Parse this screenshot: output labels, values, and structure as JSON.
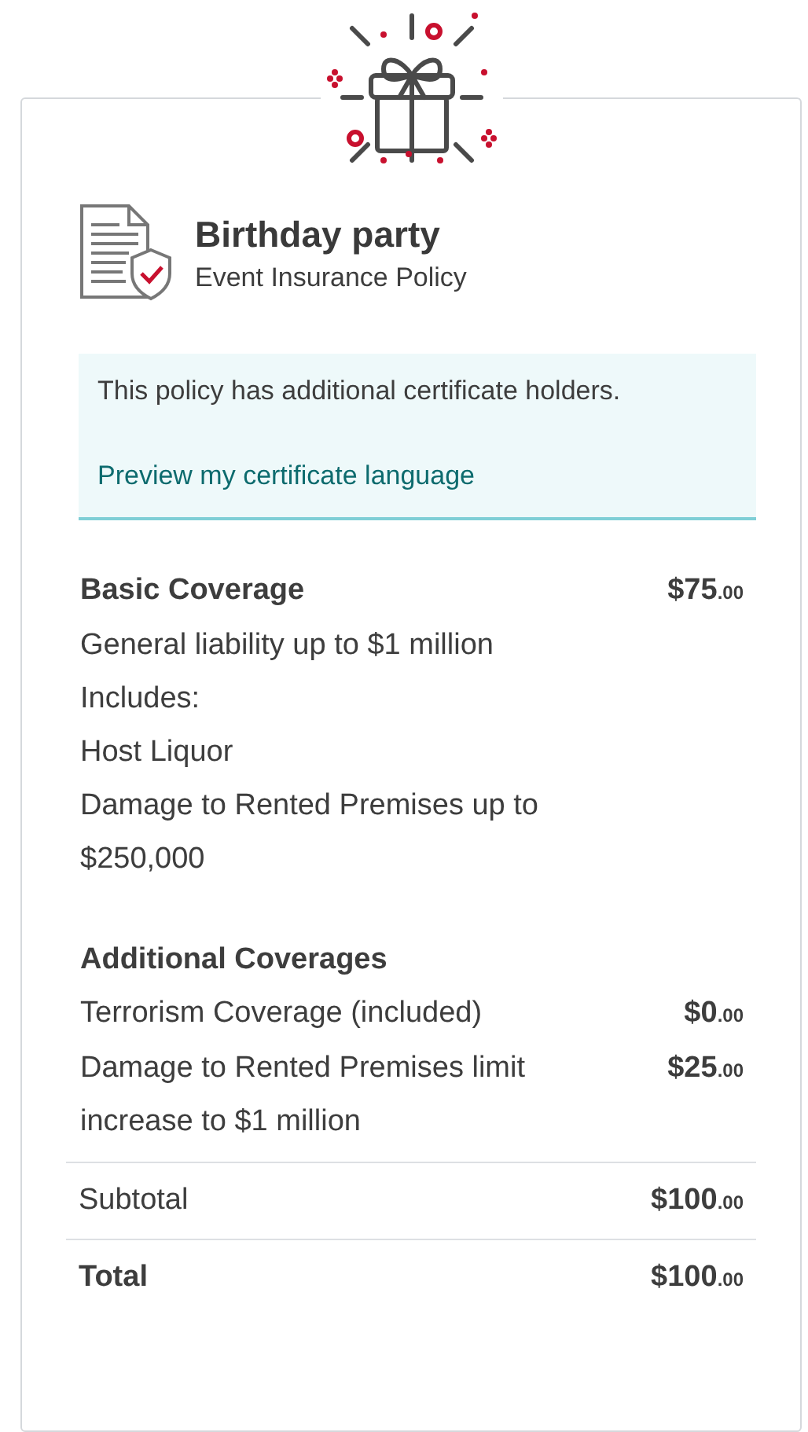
{
  "header": {
    "title": "Birthday party",
    "subtitle": "Event Insurance Policy"
  },
  "notice": {
    "text": "This policy has additional certificate holders.",
    "link": "Preview my certificate language"
  },
  "basic": {
    "heading": "Basic Coverage",
    "amount": "$75",
    "cents": ".00",
    "lines": [
      "General liability up to $1 million",
      "Includes:",
      "Host Liquor",
      "Damage to Rented Premises up to $250,000"
    ]
  },
  "additional": {
    "heading": "Additional Coverages",
    "items": [
      {
        "label": "Terrorism Coverage (included)",
        "amount": "$0",
        "cents": ".00"
      },
      {
        "label": "Damage to Rented Premises limit increase to $1 million",
        "amount": "$25",
        "cents": ".00"
      }
    ]
  },
  "totals": [
    {
      "kind": "subtotal",
      "label": "Subtotal",
      "amount": "$100",
      "cents": ".00"
    },
    {
      "kind": "total",
      "label": "Total",
      "amount": "$100",
      "cents": ".00"
    }
  ]
}
